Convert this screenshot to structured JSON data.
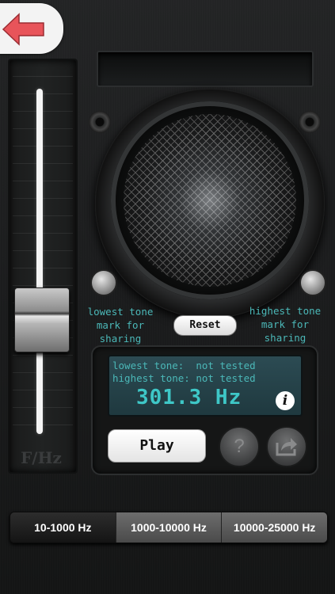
{
  "header": {
    "back_icon": "back-arrow-icon",
    "accent": "#e8545a"
  },
  "slider": {
    "axis_label": "F/Hz"
  },
  "speaker": {
    "lowest_label_lines": [
      "lowest tone",
      "mark for",
      "sharing"
    ],
    "highest_label_lines": [
      "highest tone",
      "mark for",
      "sharing"
    ],
    "reset_label": "Reset"
  },
  "display": {
    "lowest_line": "lowest tone:  not tested",
    "highest_line": "highest tone: not tested",
    "frequency": "301.3 Hz",
    "info_icon": "info-icon",
    "lcd_color": "#4bb8b8"
  },
  "controls": {
    "play_label": "Play",
    "help_icon": "question-icon",
    "help_symbol": "?",
    "share_icon": "share-icon"
  },
  "range": {
    "segments": [
      "10-1000 Hz",
      "1000-10000 Hz",
      "10000-25000 Hz"
    ],
    "selected": "10-1000 Hz"
  }
}
